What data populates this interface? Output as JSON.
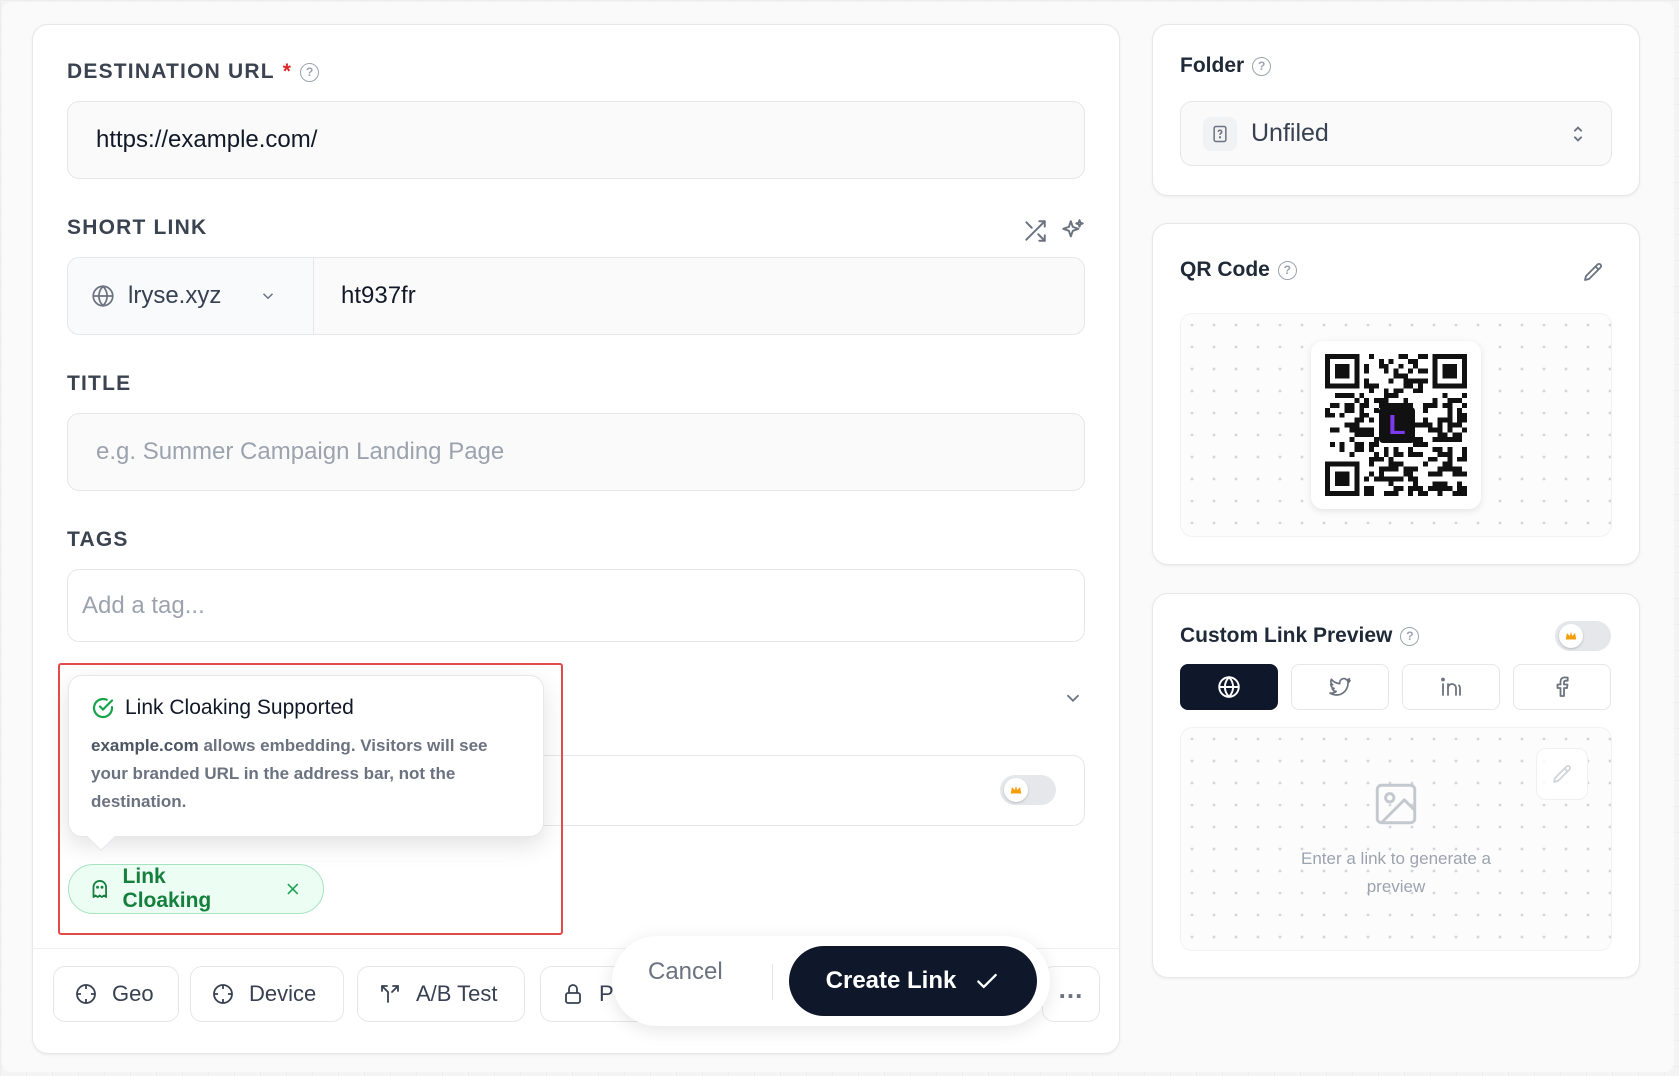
{
  "form": {
    "destination_label": "DESTINATION URL",
    "destination_required": "*",
    "destination_value": "https://example.com/",
    "short_link_label": "SHORT LINK",
    "short_domain": "lryse.xyz",
    "short_key": "ht937fr",
    "title_label": "TITLE",
    "title_placeholder": "e.g. Summer Campaign Landing Page",
    "tags_label": "TAGS",
    "tags_placeholder": "Add a tag..."
  },
  "tooltip": {
    "title": "Link Cloaking Supported",
    "domain": "example.com",
    "message": " allows embedding. Visitors will see your branded URL in the address bar, not the destination."
  },
  "chip": {
    "label": "Link Cloaking"
  },
  "toolbar": {
    "geo": "Geo",
    "device": "Device",
    "ab_test": "A/B Test",
    "password_partial": "P",
    "more": "..."
  },
  "actions": {
    "cancel": "Cancel",
    "create": "Create Link"
  },
  "sidebar": {
    "folder_title": "Folder",
    "folder_value": "Unfiled",
    "qr_title": "QR Code",
    "qr_logo_letter": "L",
    "preview_title": "Custom Link Preview",
    "preview_empty": "Enter a link to generate a preview"
  },
  "colors": {
    "primary": "#0f172a",
    "success": "#16a34a",
    "highlight": "#e34b4b",
    "qr_logo": "#7c3aed"
  }
}
